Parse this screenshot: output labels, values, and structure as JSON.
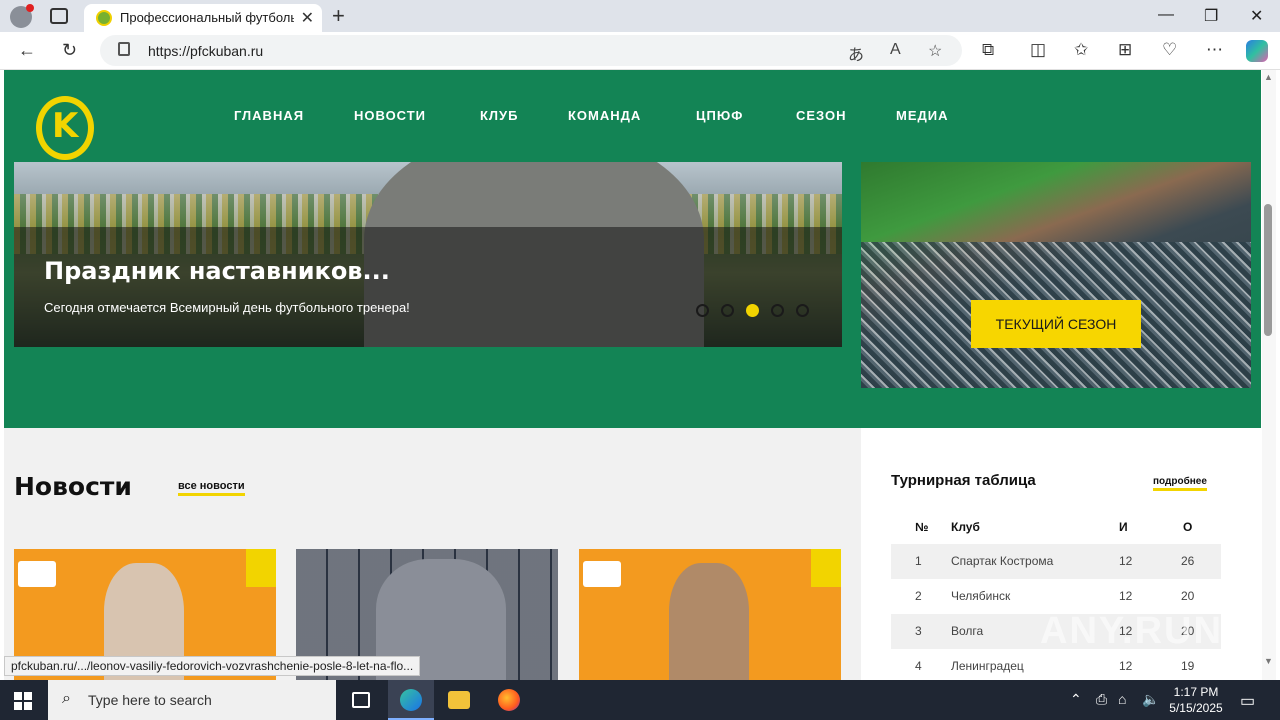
{
  "browser": {
    "tab_title": "Профессиональный футбольный клуб «Кубань»",
    "tab_close": "✕",
    "new_tab": "+",
    "url": "https://pfckuban.ru",
    "window_controls": {
      "minimize": "—",
      "maximize": "❐",
      "close": "✕"
    }
  },
  "site": {
    "nav": [
      "ГЛАВНАЯ",
      "НОВОСТИ",
      "КЛУБ",
      "КОМАНДА",
      "ЦПЮФ",
      "СЕЗОН",
      "МЕДИА"
    ],
    "hero": {
      "headline": "Праздник наставников...",
      "subtitle": "Сегодня отмечается Всемирный день футбольного тренера!",
      "slides_count": 5,
      "active_slide": 3
    },
    "season_button": "ТЕКУЩИЙ СЕЗОН",
    "news": {
      "title": "Новости",
      "all_link": "все новости"
    },
    "standings": {
      "title": "Турнирная таблица",
      "more_link": "подробнее",
      "headers": [
        "№",
        "Клуб",
        "И",
        "О"
      ],
      "rows": [
        [
          "1",
          "Спартак Кострома",
          "12",
          "26"
        ],
        [
          "2",
          "Челябинск",
          "12",
          "20"
        ],
        [
          "3",
          "Волга",
          "12",
          "20"
        ],
        [
          "4",
          "Ленинградец",
          "12",
          "19"
        ]
      ]
    }
  },
  "status_url": "pfckuban.ru/.../leonov-vasiliy-fedorovich-vozvrashchenie-posle-8-let-na-flo...",
  "watermark": "ANY.RUN",
  "taskbar": {
    "search_placeholder": "Type here to search",
    "time": "1:17 PM",
    "date": "5/15/2025"
  },
  "colors": {
    "brand_green": "#138455",
    "brand_yellow": "#f2d400"
  }
}
